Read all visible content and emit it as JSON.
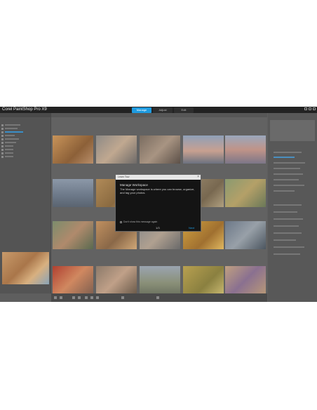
{
  "app": {
    "title": "Corel PaintShop Pro X9"
  },
  "workspace_tabs": [
    {
      "label": "Manage",
      "active": true
    },
    {
      "label": "Adjust",
      "active": false
    },
    {
      "label": "Edit",
      "active": false
    }
  ],
  "dialog": {
    "title": "Learn Tour",
    "heading": "Manage Workspace",
    "body": "The Manage workspace is where you can browse, organize, and tag your photos.",
    "checkbox_label": "Don't show this message again",
    "pager": "1/3",
    "next_label": "Next"
  },
  "colors": {
    "accent": "#1e9be0",
    "app_bg": "#5e5e5e",
    "titlebar": "#222222",
    "dialog_bg": "#141414"
  },
  "thumbnails": [
    {
      "name": "portrait-woman-sunlight"
    },
    {
      "name": "girl-with-camera"
    },
    {
      "name": "hands-holding-camera"
    },
    {
      "name": "pier-at-sunset"
    },
    {
      "name": "misty-seascape"
    },
    {
      "name": "coastal-rocks"
    },
    {
      "name": "autumn-field"
    },
    {
      "name": "tree-silhouette"
    },
    {
      "name": "child-with-flowers"
    },
    {
      "name": "mirror-ball-portrait"
    },
    {
      "name": "woman-with-guitar"
    },
    {
      "name": "street-cafe"
    },
    {
      "name": "sunset-hills"
    },
    {
      "name": "old-window"
    },
    {
      "name": "woman-with-hat"
    },
    {
      "name": "girl-smiling"
    },
    {
      "name": "bicycle-on-road"
    },
    {
      "name": "child-in-field"
    },
    {
      "name": "girl-with-balloons"
    }
  ]
}
